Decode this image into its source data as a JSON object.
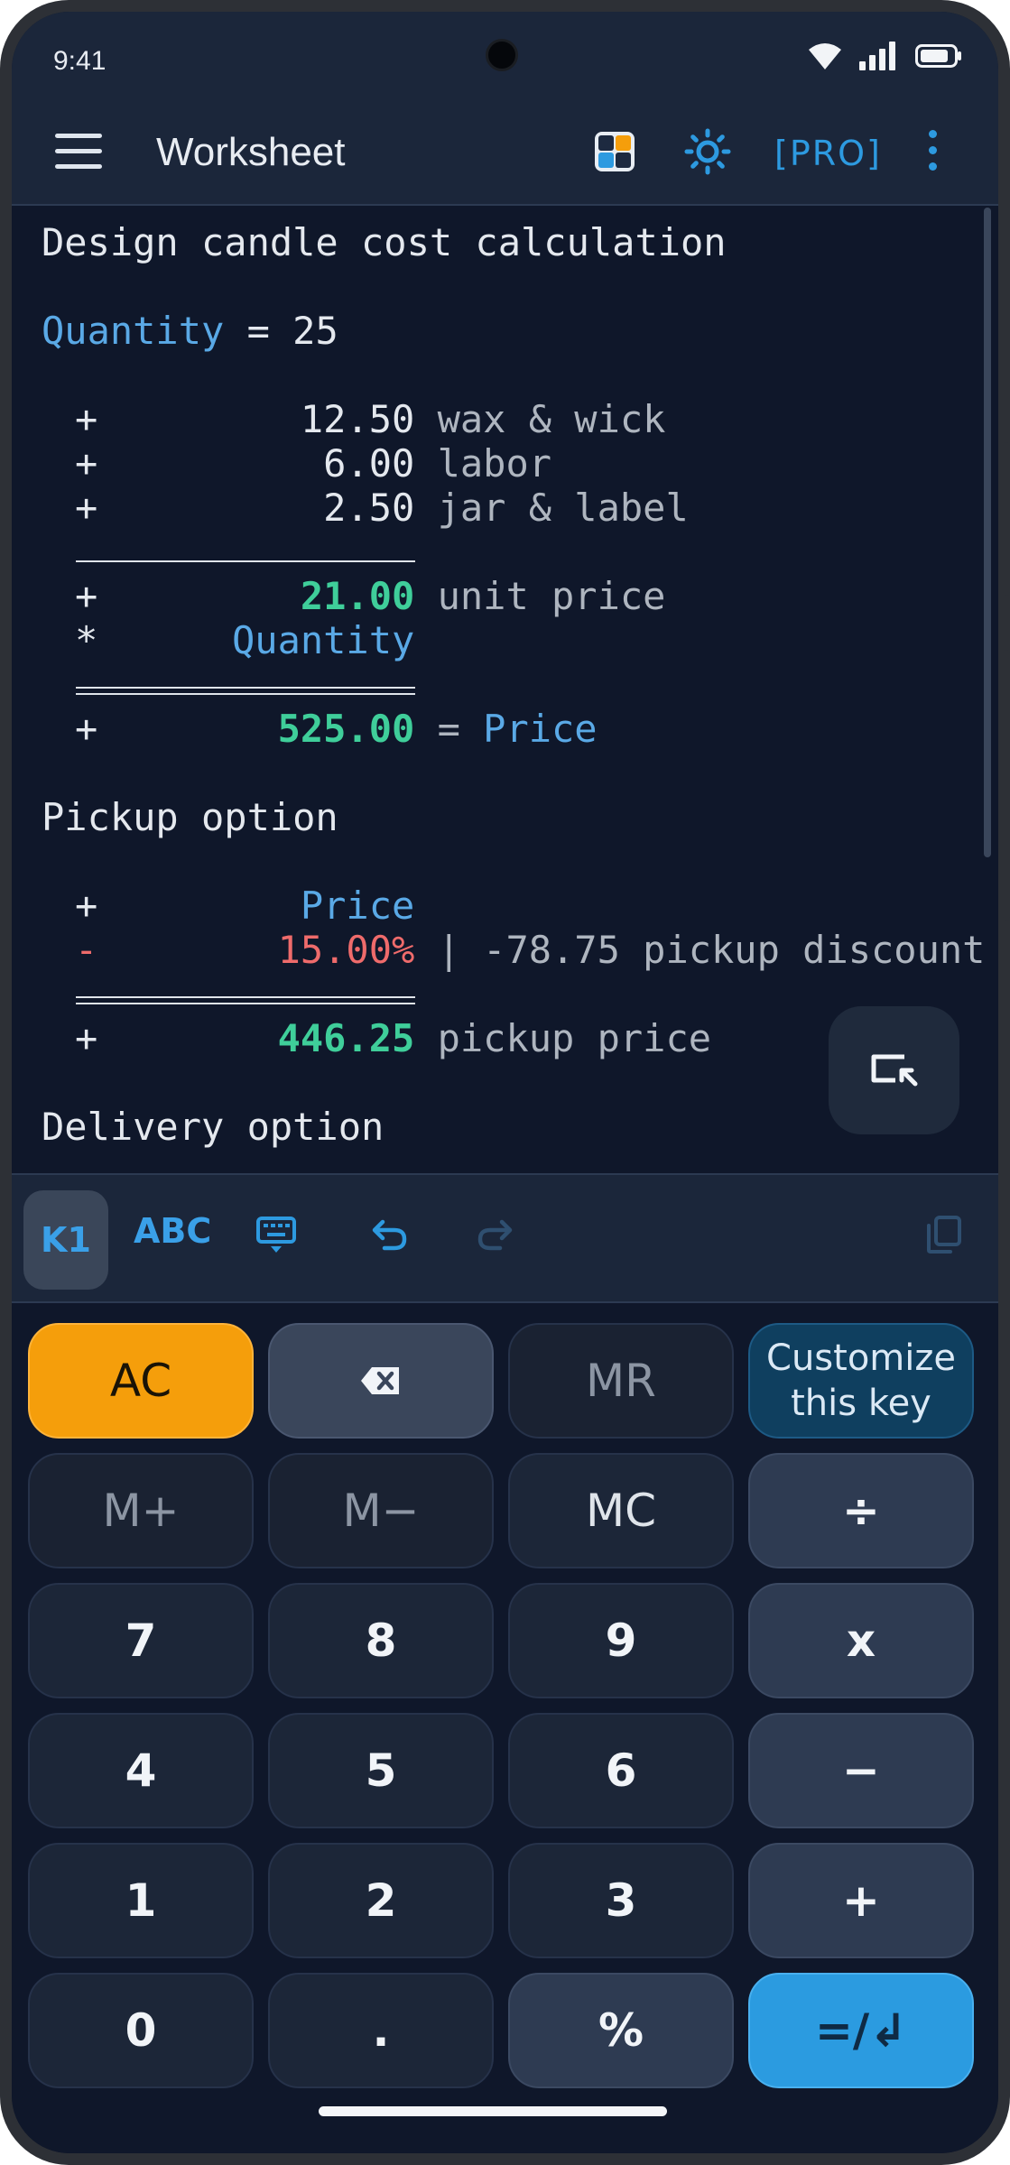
{
  "status_bar": {
    "time": "9:41"
  },
  "app_bar": {
    "title": "Worksheet",
    "pro_label": "[PRO]"
  },
  "worksheet": {
    "title": "Design candle cost calculation",
    "quantity_line": {
      "name": "Quantity",
      "op": " = ",
      "value": "25"
    },
    "cost_lines": [
      {
        "op": "+",
        "amount": "12.50",
        "label": "wax & wick"
      },
      {
        "op": "+",
        "amount": "6.00",
        "label": "labor"
      },
      {
        "op": "+",
        "amount": "2.50",
        "label": "jar & label"
      }
    ],
    "unit_line": {
      "op": "+",
      "amount": "21.00",
      "label": "unit price"
    },
    "multiply_line": {
      "op": "*",
      "ref": "Quantity"
    },
    "price_line": {
      "op": "+",
      "amount": "525.00",
      "eq": " = ",
      "name": "Price"
    },
    "pickup_heading": "Pickup option",
    "pickup_ref_line": {
      "op": "+",
      "ref": "Price"
    },
    "pickup_discount_line": {
      "op": "-",
      "percent": "15.00%",
      "rest": " | -78.75 pickup discount"
    },
    "pickup_total_line": {
      "op": "+",
      "amount": "446.25",
      "label": "pickup price"
    },
    "delivery_heading": "Delivery option"
  },
  "toolbar": {
    "k1": "K1",
    "abc": "ABC"
  },
  "keypad": {
    "ac": "AC",
    "mr": "MR",
    "customize_line1": "Customize",
    "customize_line2": "this key",
    "m_plus": "M+",
    "m_minus": "M−",
    "mc": "MC",
    "divide": "÷",
    "seven": "7",
    "eight": "8",
    "nine": "9",
    "multiply": "x",
    "four": "4",
    "five": "5",
    "six": "6",
    "minus": "−",
    "one": "1",
    "two": "2",
    "three": "3",
    "plus": "+",
    "zero": "0",
    "dot": ".",
    "percent": "%",
    "equals": "=/↲"
  },
  "colors": {
    "background": "#0f172a",
    "accent": "#2d9ae0",
    "green": "#3fce9a",
    "red": "#ef6b6b",
    "ac_orange": "#f59e0b",
    "equals_blue": "#2b9be0"
  }
}
